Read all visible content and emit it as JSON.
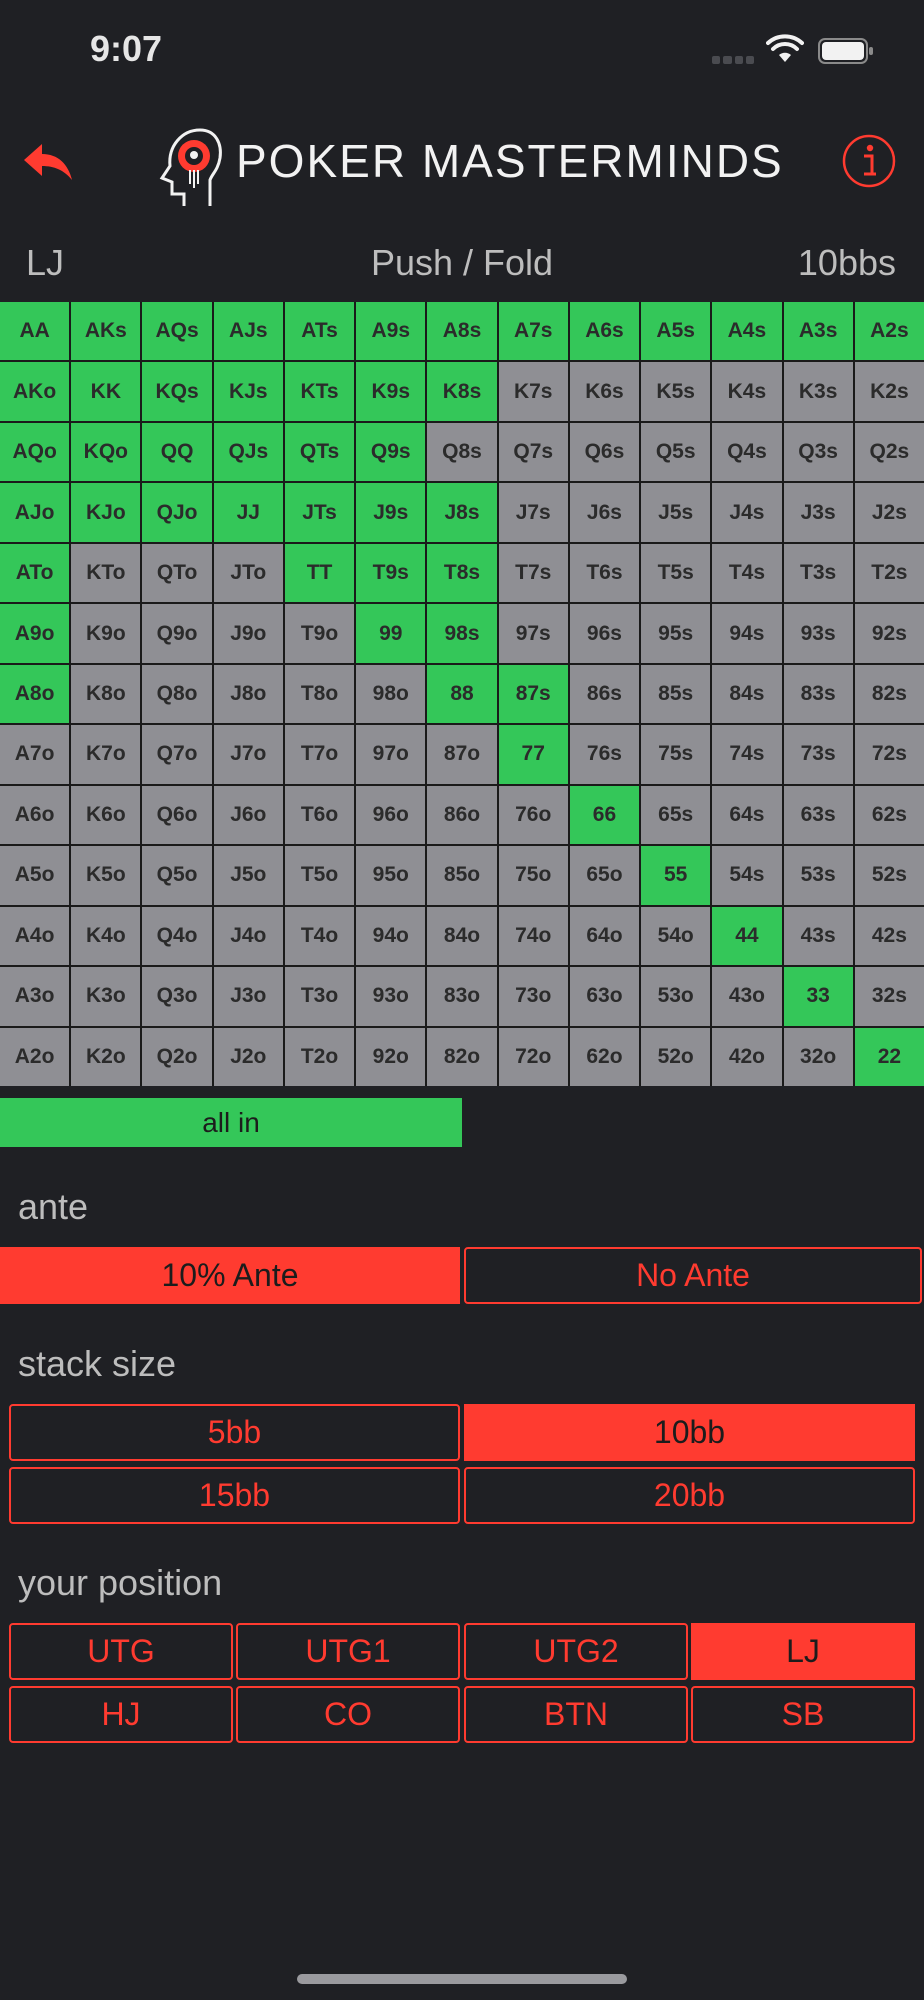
{
  "status": {
    "time": "9:07"
  },
  "header": {
    "title": "POKER MASTERMINDS",
    "back_icon": "back-arrow-icon",
    "info_icon": "info-icon",
    "accent": "#ff3b30"
  },
  "info": {
    "position": "LJ",
    "mode": "Push / Fold",
    "stack": "10bbs"
  },
  "grid": {
    "rows": [
      [
        "AA",
        "AKs",
        "AQs",
        "AJs",
        "ATs",
        "A9s",
        "A8s",
        "A7s",
        "A6s",
        "A5s",
        "A4s",
        "A3s",
        "A2s"
      ],
      [
        "AKo",
        "KK",
        "KQs",
        "KJs",
        "KTs",
        "K9s",
        "K8s",
        "K7s",
        "K6s",
        "K5s",
        "K4s",
        "K3s",
        "K2s"
      ],
      [
        "AQo",
        "KQo",
        "QQ",
        "QJs",
        "QTs",
        "Q9s",
        "Q8s",
        "Q7s",
        "Q6s",
        "Q5s",
        "Q4s",
        "Q3s",
        "Q2s"
      ],
      [
        "AJo",
        "KJo",
        "QJo",
        "JJ",
        "JTs",
        "J9s",
        "J8s",
        "J7s",
        "J6s",
        "J5s",
        "J4s",
        "J3s",
        "J2s"
      ],
      [
        "ATo",
        "KTo",
        "QTo",
        "JTo",
        "TT",
        "T9s",
        "T8s",
        "T7s",
        "T6s",
        "T5s",
        "T4s",
        "T3s",
        "T2s"
      ],
      [
        "A9o",
        "K9o",
        "Q9o",
        "J9o",
        "T9o",
        "99",
        "98s",
        "97s",
        "96s",
        "95s",
        "94s",
        "93s",
        "92s"
      ],
      [
        "A8o",
        "K8o",
        "Q8o",
        "J8o",
        "T8o",
        "98o",
        "88",
        "87s",
        "86s",
        "85s",
        "84s",
        "83s",
        "82s"
      ],
      [
        "A7o",
        "K7o",
        "Q7o",
        "J7o",
        "T7o",
        "97o",
        "87o",
        "77",
        "76s",
        "75s",
        "74s",
        "73s",
        "72s"
      ],
      [
        "A6o",
        "K6o",
        "Q6o",
        "J6o",
        "T6o",
        "96o",
        "86o",
        "76o",
        "66",
        "65s",
        "64s",
        "63s",
        "62s"
      ],
      [
        "A5o",
        "K5o",
        "Q5o",
        "J5o",
        "T5o",
        "95o",
        "85o",
        "75o",
        "65o",
        "55",
        "54s",
        "53s",
        "52s"
      ],
      [
        "A4o",
        "K4o",
        "Q4o",
        "J4o",
        "T4o",
        "94o",
        "84o",
        "74o",
        "64o",
        "54o",
        "44",
        "43s",
        "42s"
      ],
      [
        "A3o",
        "K3o",
        "Q3o",
        "J3o",
        "T3o",
        "93o",
        "83o",
        "73o",
        "63o",
        "53o",
        "43o",
        "33",
        "32s"
      ],
      [
        "A2o",
        "K2o",
        "Q2o",
        "J2o",
        "T2o",
        "92o",
        "82o",
        "72o",
        "62o",
        "52o",
        "42o",
        "32o",
        "22"
      ]
    ],
    "all_in": [
      "AA",
      "AKs",
      "AQs",
      "AJs",
      "ATs",
      "A9s",
      "A8s",
      "A7s",
      "A6s",
      "A5s",
      "A4s",
      "A3s",
      "A2s",
      "AKo",
      "KK",
      "KQs",
      "KJs",
      "KTs",
      "K9s",
      "K8s",
      "AQo",
      "KQo",
      "QQ",
      "QJs",
      "QTs",
      "Q9s",
      "AJo",
      "KJo",
      "QJo",
      "JJ",
      "JTs",
      "J9s",
      "J8s",
      "ATo",
      "TT",
      "T9s",
      "T8s",
      "A9o",
      "99",
      "98s",
      "A8o",
      "88",
      "87s",
      "77",
      "66",
      "55",
      "44",
      "33",
      "22"
    ],
    "colors": {
      "all_in": "#34c759",
      "fold": "#8f8f94"
    }
  },
  "legend": {
    "label": "all in"
  },
  "ante": {
    "label": "ante",
    "options": [
      "10% Ante",
      "No Ante"
    ],
    "selected": "10% Ante"
  },
  "stack_size": {
    "label": "stack size",
    "options": [
      "5bb",
      "10bb",
      "15bb",
      "20bb"
    ],
    "selected": "10bb"
  },
  "position": {
    "label": "your position",
    "options": [
      "UTG",
      "UTG1",
      "UTG2",
      "LJ",
      "HJ",
      "CO",
      "BTN",
      "SB"
    ],
    "selected": "LJ"
  }
}
